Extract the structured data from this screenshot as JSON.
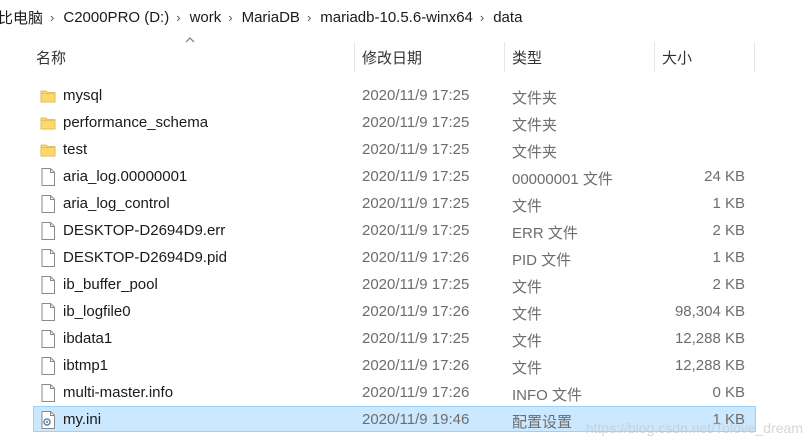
{
  "breadcrumb": [
    "比电脑",
    "C2000PRO (D:)",
    "work",
    "MariaDB",
    "mariadb-10.5.6-winx64",
    "data"
  ],
  "columns": {
    "name": "名称",
    "date": "修改日期",
    "type": "类型",
    "size": "大小"
  },
  "files": [
    {
      "name": "mysql",
      "date": "2020/11/9 17:25",
      "type": "文件夹",
      "size": "",
      "icon": "folder-icon"
    },
    {
      "name": "performance_schema",
      "date": "2020/11/9 17:25",
      "type": "文件夹",
      "size": "",
      "icon": "folder-icon"
    },
    {
      "name": "test",
      "date": "2020/11/9 17:25",
      "type": "文件夹",
      "size": "",
      "icon": "folder-icon"
    },
    {
      "name": "aria_log.00000001",
      "date": "2020/11/9 17:25",
      "type": "00000001 文件",
      "size": "24 KB",
      "icon": "file-icon"
    },
    {
      "name": "aria_log_control",
      "date": "2020/11/9 17:25",
      "type": "文件",
      "size": "1 KB",
      "icon": "file-icon"
    },
    {
      "name": "DESKTOP-D2694D9.err",
      "date": "2020/11/9 17:25",
      "type": "ERR 文件",
      "size": "2 KB",
      "icon": "file-icon"
    },
    {
      "name": "DESKTOP-D2694D9.pid",
      "date": "2020/11/9 17:26",
      "type": "PID 文件",
      "size": "1 KB",
      "icon": "file-icon"
    },
    {
      "name": "ib_buffer_pool",
      "date": "2020/11/9 17:25",
      "type": "文件",
      "size": "2 KB",
      "icon": "file-icon"
    },
    {
      "name": "ib_logfile0",
      "date": "2020/11/9 17:26",
      "type": "文件",
      "size": "98,304 KB",
      "icon": "file-icon"
    },
    {
      "name": "ibdata1",
      "date": "2020/11/9 17:25",
      "type": "文件",
      "size": "12,288 KB",
      "icon": "file-icon"
    },
    {
      "name": "ibtmp1",
      "date": "2020/11/9 17:26",
      "type": "文件",
      "size": "12,288 KB",
      "icon": "file-icon"
    },
    {
      "name": "multi-master.info",
      "date": "2020/11/9 17:26",
      "type": "INFO 文件",
      "size": "0 KB",
      "icon": "file-icon"
    },
    {
      "name": "my.ini",
      "date": "2020/11/9 19:46",
      "type": "配置设置",
      "size": "1 KB",
      "icon": "settings-file-icon",
      "selected": true
    }
  ],
  "watermark": "https://blog.csdn.net/Tolove_dream",
  "colors": {
    "selection": "#cce8ff",
    "selection_border": "#99d1ff",
    "folder": "#f8d775"
  }
}
